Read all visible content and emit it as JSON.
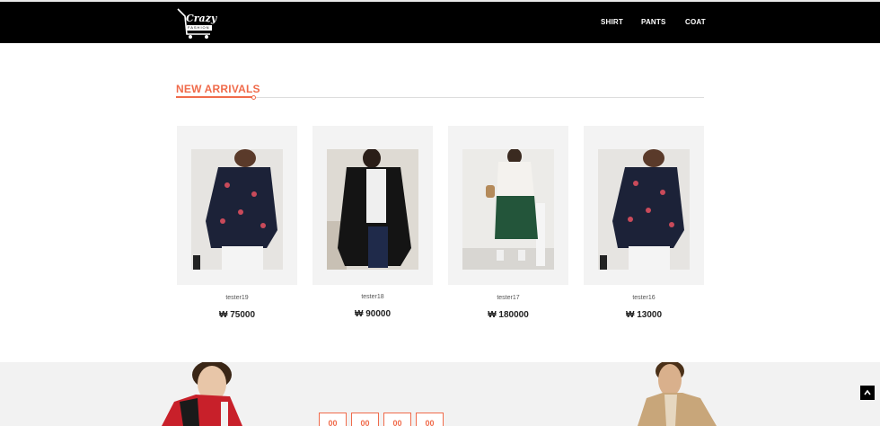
{
  "header": {
    "logo_text": "Crazy",
    "logo_sub": "FASHION",
    "nav": [
      "SHIRT",
      "PANTS",
      "COAT"
    ]
  },
  "section": {
    "title": "NEW ARRIVALS"
  },
  "products": [
    {
      "name": "tester19",
      "price": "₩ 75000"
    },
    {
      "name": "tester18",
      "price": "₩ 90000"
    },
    {
      "name": "tester17",
      "price": "₩ 180000"
    },
    {
      "name": "tester16",
      "price": "₩ 13000"
    }
  ],
  "countdown": [
    "00",
    "00",
    "00",
    "00"
  ],
  "colors": {
    "accent": "#f06b4b",
    "header_bg": "#000000",
    "card_bg": "#f3f3f3"
  },
  "icons": {
    "scroll_top": "chevron-up-icon",
    "logo": "shopping-cart-icon"
  }
}
